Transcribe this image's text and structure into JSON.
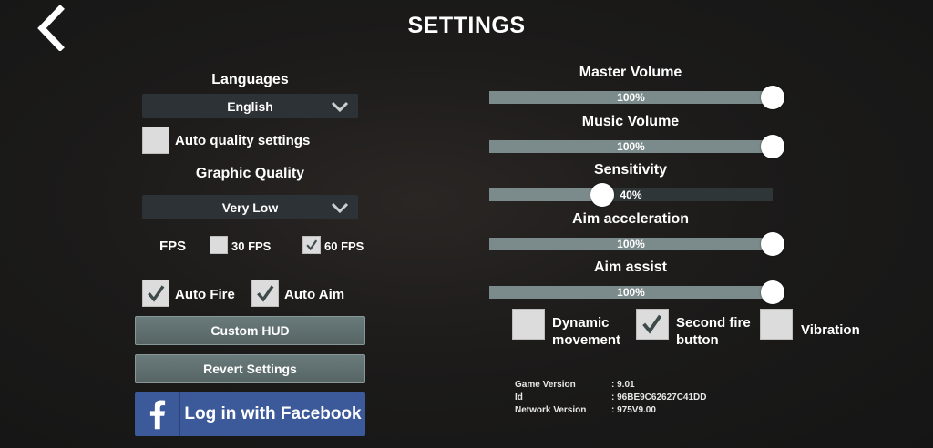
{
  "header": {
    "title": "SETTINGS"
  },
  "left": {
    "languages_label": "Languages",
    "language_value": "English",
    "auto_quality_label": "Auto quality settings",
    "auto_quality_checked": false,
    "graphic_quality_label": "Graphic Quality",
    "graphic_quality_value": "Very Low",
    "fps_label": "FPS",
    "fps_options": [
      {
        "label": "30 FPS",
        "checked": false
      },
      {
        "label": "60 FPS",
        "checked": true
      }
    ],
    "auto_fire_label": "Auto Fire",
    "auto_fire_checked": true,
    "auto_aim_label": "Auto Aim",
    "auto_aim_checked": true,
    "custom_hud_label": "Custom HUD",
    "revert_label": "Revert Settings",
    "facebook_label": "Log in with Facebook"
  },
  "sliders": [
    {
      "label": "Master Volume",
      "value_text": "100%",
      "value": 100
    },
    {
      "label": "Music Volume",
      "value_text": "100%",
      "value": 100
    },
    {
      "label": "Sensitivity",
      "value_text": "40%",
      "value": 40
    },
    {
      "label": "Aim acceleration",
      "value_text": "100%",
      "value": 100
    },
    {
      "label": "Aim assist",
      "value_text": "100%",
      "value": 100
    }
  ],
  "toggles": {
    "dynamic_movement": {
      "label_line1": "Dynamic",
      "label_line2": "movement",
      "checked": false
    },
    "second_fire": {
      "label_line1": "Second fire",
      "label_line2": "button",
      "checked": true
    },
    "vibration": {
      "label": "Vibration",
      "checked": false
    }
  },
  "info": {
    "game_version_label": "Game Version",
    "game_version_value": ": 9.01",
    "id_label": "Id",
    "id_value": ": 96BE9C62627C41DD",
    "network_version_label": "Network Version",
    "network_version_value": ": 975V9.00"
  },
  "colors": {
    "track": "#2f3638",
    "fill": "#7b8a8a",
    "button": "#5f6f6f",
    "facebook": "#3c5a9a",
    "dropdown": "#2c3236"
  },
  "icons": [
    "back-arrow-icon",
    "chevron-down-icon",
    "checkmark-icon",
    "facebook-icon"
  ]
}
